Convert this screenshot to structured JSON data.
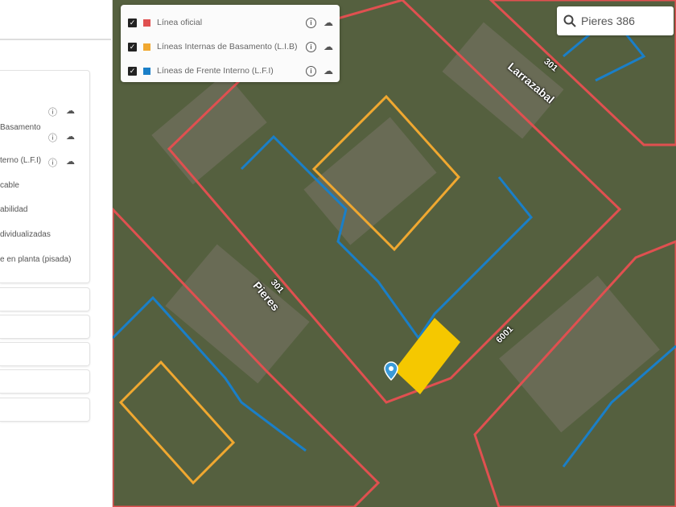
{
  "sidebar": {
    "layers": [
      {
        "label": ""
      },
      {
        "label": "Basamento"
      },
      {
        "label": "terno (L.F.I)"
      },
      {
        "label": "cable"
      },
      {
        "label": "abilidad"
      },
      {
        "label": "dividualizadas"
      },
      {
        "label": "e en planta (pisada)"
      }
    ]
  },
  "legend": {
    "items": [
      {
        "label": "Línea oficial",
        "color": "#e05050"
      },
      {
        "label": "Líneas Internas de Basamento (L.I.B)",
        "color": "#f0a830"
      },
      {
        "label": "Líneas de Frente Interno (L.F.I)",
        "color": "#1a7fc8"
      }
    ],
    "info_icon": "i",
    "download_icon": "☁"
  },
  "search": {
    "icon": "search-icon",
    "value": "Pieres 386"
  },
  "map": {
    "streets": [
      {
        "name": "Larrazabal",
        "number": "301"
      },
      {
        "name": "Pieres",
        "number": "301"
      },
      {
        "name": "",
        "number": "6001"
      }
    ]
  }
}
